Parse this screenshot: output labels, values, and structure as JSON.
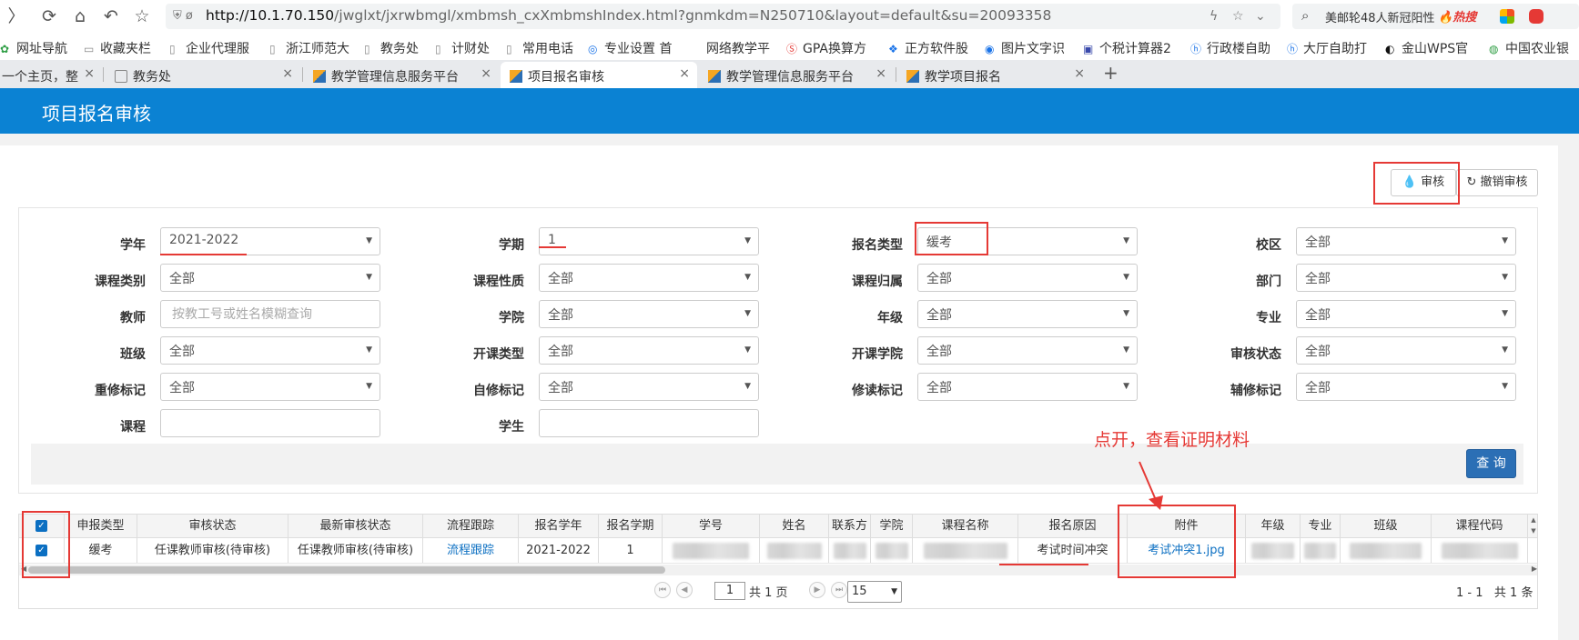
{
  "browser": {
    "url_host": "http://10.1.70.150",
    "url_path": "/jwglxt/jxrwbmgl/xmbmsh_cxXmbmshIndex.html?gnmkdm=N250710&layout=default&su=20093358",
    "search_text": "美邮轮48人新冠阳性",
    "search_hot": "热搜",
    "bookmarks": [
      "网址导航",
      "收藏夹栏",
      "企业代理服",
      "浙江师范大",
      "教务处",
      "计财处",
      "常用电话",
      "专业设置 首",
      "网络教学平",
      "GPA换算方",
      "正方软件股",
      "图片文字识",
      "个税计算器2",
      "行政楼自助",
      "大厅自助打",
      "金山WPS官",
      "中国农业银"
    ],
    "tabs": [
      "一个主页，整",
      "教务处",
      "教学管理信息服务平台",
      "项目报名审核",
      "教学管理信息服务平台",
      "教学项目报名"
    ],
    "active_tab": 3
  },
  "page": {
    "title": "项目报名审核",
    "buttons": {
      "audit": "审核",
      "revoke": "撤销审核",
      "query": "查 询"
    }
  },
  "filters": {
    "xn": {
      "label": "学年",
      "value": "2021-2022"
    },
    "xq": {
      "label": "学期",
      "value": "1"
    },
    "bmlx": {
      "label": "报名类型",
      "value": "缓考"
    },
    "xiaoqu": {
      "label": "校区",
      "value": "全部"
    },
    "kclb": {
      "label": "课程类别",
      "value": "全部"
    },
    "kcxz": {
      "label": "课程性质",
      "value": "全部"
    },
    "kcgs": {
      "label": "课程归属",
      "value": "全部"
    },
    "bm": {
      "label": "部门",
      "value": "全部"
    },
    "js": {
      "label": "教师",
      "placeholder": "按教工号或姓名模糊查询"
    },
    "xy": {
      "label": "学院",
      "value": "全部"
    },
    "nj": {
      "label": "年级",
      "value": "全部"
    },
    "zy": {
      "label": "专业",
      "value": "全部"
    },
    "bj": {
      "label": "班级",
      "value": "全部"
    },
    "kklx": {
      "label": "开课类型",
      "value": "全部"
    },
    "kkxy": {
      "label": "开课学院",
      "value": "全部"
    },
    "shzt": {
      "label": "审核状态",
      "value": "全部"
    },
    "cxbj": {
      "label": "重修标记",
      "value": "全部"
    },
    "zxbj": {
      "label": "自修标记",
      "value": "全部"
    },
    "xdbj": {
      "label": "修读标记",
      "value": "全部"
    },
    "fxbj": {
      "label": "辅修标记",
      "value": "全部"
    },
    "kc": {
      "label": "课程",
      "placeholder": ""
    },
    "xs": {
      "label": "学生",
      "placeholder": ""
    }
  },
  "table": {
    "headers": [
      "申报类型",
      "审核状态",
      "最新审核状态",
      "流程跟踪",
      "报名学年",
      "报名学期",
      "学号",
      "姓名",
      "联系方",
      "学院",
      "课程名称",
      "报名原因",
      "附件",
      "年级",
      "专业",
      "班级",
      "课程代码"
    ],
    "rows": [
      {
        "sblx": "缓考",
        "shzt": "任课教师审核(待审核)",
        "zxshzt": "任课教师审核(待审核)",
        "lcgz": "流程跟踪",
        "bmxn": "2021-2022",
        "bmxq": "1",
        "bmyy": "考试时间冲突",
        "fj": "考试冲突1.jpg",
        "selected": true
      }
    ]
  },
  "pager": {
    "page": "1",
    "total_pages_text": "共 1 页",
    "page_size": "15",
    "range_text": "1 - 1",
    "total_text": "共 1 条"
  },
  "annotation": {
    "text": "点开，查看证明材料"
  },
  "colors": {
    "header_blue": "#0b82d3",
    "link_blue": "#0b6fc2",
    "annotation_red": "#e53935",
    "query_btn": "#2b6fb5"
  }
}
